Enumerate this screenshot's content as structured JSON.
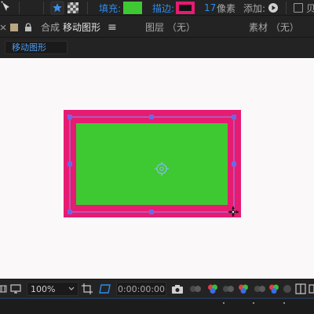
{
  "toolbar": {
    "fill_label": "填充:",
    "fill_color": "#3ec932",
    "stroke_label": "描边:",
    "stroke_color": "#e61b72",
    "stroke_width": "17",
    "stroke_unit": "像素",
    "add_label": "添加:",
    "truncated_label": "贝",
    "icons": [
      "pin-tool-icon",
      "star-icon",
      "checker-icon",
      "play-circle-icon",
      "checkbox-icon"
    ]
  },
  "panel_tabs": {
    "composition_prefix": "合成",
    "composition_name": "移动图形",
    "menu_glyph": "≡",
    "layer_panel": "图层 （无）",
    "footage_panel": "素材 （无）"
  },
  "breadcrumb": {
    "label": "移动图形"
  },
  "canvas": {
    "background": "#fbf8fa",
    "shape_fill": "#3ec932",
    "shape_stroke": "#e61b72",
    "handle_color": "#6a6ae6"
  },
  "bottom_bar": {
    "zoom": "100%",
    "timecode": "0:00:00:00"
  },
  "colors": {
    "accent_blue": "#2d8ceb",
    "panel_bg": "#232323"
  }
}
